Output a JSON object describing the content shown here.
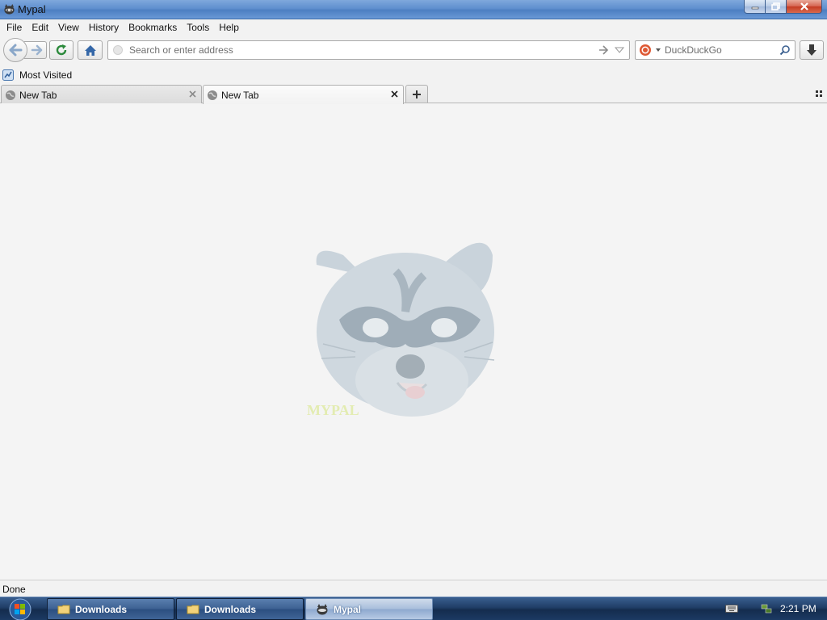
{
  "window": {
    "title": "Mypal"
  },
  "menu": [
    "File",
    "Edit",
    "View",
    "History",
    "Bookmarks",
    "Tools",
    "Help"
  ],
  "navbar": {
    "url_placeholder": "Search or enter address",
    "search_placeholder": "DuckDuckGo"
  },
  "bookmarks": {
    "most_visited": "Most Visited"
  },
  "tabs": [
    {
      "label": "New Tab",
      "active": false
    },
    {
      "label": "New Tab",
      "active": true
    }
  ],
  "content": {
    "logo_text": "MYPAL"
  },
  "status": {
    "text": "Done"
  },
  "taskbar": {
    "buttons": [
      {
        "label": "Downloads",
        "icon": "folder-icon"
      },
      {
        "label": "Downloads",
        "icon": "folder-icon"
      },
      {
        "label": "Mypal",
        "icon": "mypal-app-icon",
        "active": true
      }
    ],
    "clock": "2:21 PM"
  },
  "colors": {
    "taskbar": "#1f3d66",
    "titlebar": "#5f8fcf",
    "content_bg": "#f4f4f4"
  }
}
